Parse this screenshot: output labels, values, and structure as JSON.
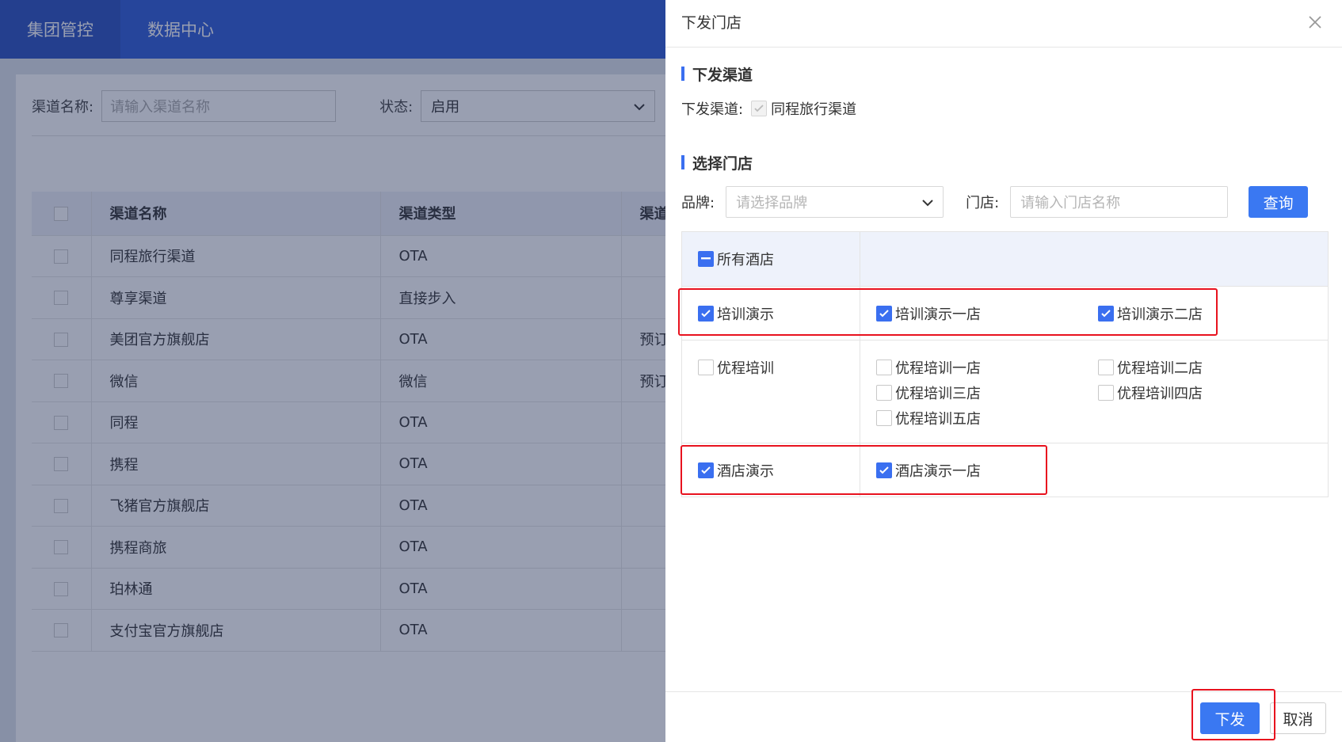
{
  "topnav": {
    "tabs": [
      {
        "label": "集团管控",
        "active": true
      },
      {
        "label": "数据中心",
        "active": false
      }
    ]
  },
  "background": {
    "filter": {
      "channel_name_label": "渠道名称:",
      "channel_name_placeholder": "请输入渠道名称",
      "status_label": "状态:",
      "status_value": "启用"
    },
    "table": {
      "headers": [
        "渠道名称",
        "渠道类型",
        "渠道"
      ],
      "rows": [
        {
          "name": "同程旅行渠道",
          "type": "OTA",
          "extra": ""
        },
        {
          "name": "尊享渠道",
          "type": "直接步入",
          "extra": ""
        },
        {
          "name": "美团官方旗舰店",
          "type": "OTA",
          "extra": "预订"
        },
        {
          "name": "微信",
          "type": "微信",
          "extra": "预订"
        },
        {
          "name": "同程",
          "type": "OTA",
          "extra": ""
        },
        {
          "name": "携程",
          "type": "OTA",
          "extra": ""
        },
        {
          "name": "飞猪官方旗舰店",
          "type": "OTA",
          "extra": ""
        },
        {
          "name": "携程商旅",
          "type": "OTA",
          "extra": ""
        },
        {
          "name": "珀林通",
          "type": "OTA",
          "extra": ""
        },
        {
          "name": "支付宝官方旗舰店",
          "type": "OTA",
          "extra": ""
        }
      ]
    }
  },
  "drawer": {
    "title": "下发门店",
    "section_channel": "下发渠道",
    "channel_label": "下发渠道:",
    "channel_value": "同程旅行渠道",
    "section_store": "选择门店",
    "brand_label": "品牌:",
    "brand_placeholder": "请选择品牌",
    "store_label": "门店:",
    "store_placeholder": "请输入门店名称",
    "query_button": "查询",
    "all_hotels": "所有酒店",
    "groups": [
      {
        "brand": "培训演示",
        "checked": true,
        "stores": [
          {
            "name": "培训演示一店",
            "checked": true
          },
          {
            "name": "培训演示二店",
            "checked": true
          }
        ]
      },
      {
        "brand": "优程培训",
        "checked": false,
        "stores": [
          {
            "name": "优程培训一店",
            "checked": false
          },
          {
            "name": "优程培训二店",
            "checked": false
          },
          {
            "name": "优程培训三店",
            "checked": false
          },
          {
            "name": "优程培训四店",
            "checked": false
          },
          {
            "name": "优程培训五店",
            "checked": false
          }
        ]
      },
      {
        "brand": "酒店演示",
        "checked": true,
        "stores": [
          {
            "name": "酒店演示一店",
            "checked": true
          }
        ]
      }
    ],
    "submit_button": "下发",
    "cancel_button": "取消"
  },
  "colors": {
    "primary": "#3a78f2",
    "nav": "#2f5bd7",
    "highlight": "#e8121e"
  }
}
